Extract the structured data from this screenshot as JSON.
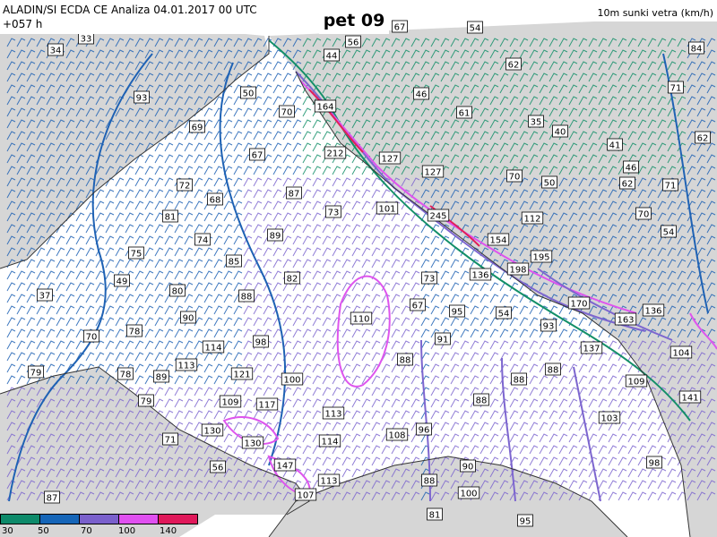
{
  "header": {
    "title_line1": "ALADIN/SI ECDA CE Analiza 04.01.2017 00 UTC",
    "title_line2": "+057 h",
    "day": "pet 09",
    "variable": "10m sunki vetra (km/h)"
  },
  "legend": {
    "colors": [
      "#0d8a6a",
      "#1565b8",
      "#7a60cc",
      "#e050f0",
      "#e0185a"
    ],
    "labels": [
      "30",
      "50",
      "70",
      "100",
      "140"
    ]
  },
  "contour_colors": {
    "c30": "#138f68",
    "c50": "#1f62b4",
    "c70": "#7d66cf",
    "c100": "#de55ee",
    "c140": "#e0205a",
    "coast": "#333333"
  },
  "station_values": [
    "33",
    "34",
    "56",
    "44",
    "67",
    "54",
    "62",
    "84",
    "93",
    "50",
    "70",
    "164",
    "46",
    "61",
    "35",
    "40",
    "71",
    "62",
    "69",
    "67",
    "212",
    "127",
    "127",
    "41",
    "46",
    "62",
    "72",
    "68",
    "87",
    "73",
    "101",
    "70",
    "50",
    "71",
    "70",
    "81",
    "74",
    "89",
    "245",
    "112",
    "154",
    "54",
    "75",
    "85",
    "195",
    "198",
    "37",
    "49",
    "80",
    "88",
    "82",
    "73",
    "136",
    "170",
    "136",
    "90",
    "110",
    "67",
    "95",
    "54",
    "93",
    "163",
    "70",
    "78",
    "98",
    "91",
    "137",
    "104",
    "79",
    "114",
    "113",
    "88",
    "88",
    "78",
    "89",
    "121",
    "100",
    "88",
    "109",
    "141",
    "79",
    "109",
    "117",
    "113",
    "88",
    "103",
    "130",
    "108",
    "96",
    "71",
    "130",
    "114",
    "98",
    "56",
    "147",
    "90",
    "113",
    "88",
    "107",
    "100",
    "87",
    "81",
    "95"
  ]
}
